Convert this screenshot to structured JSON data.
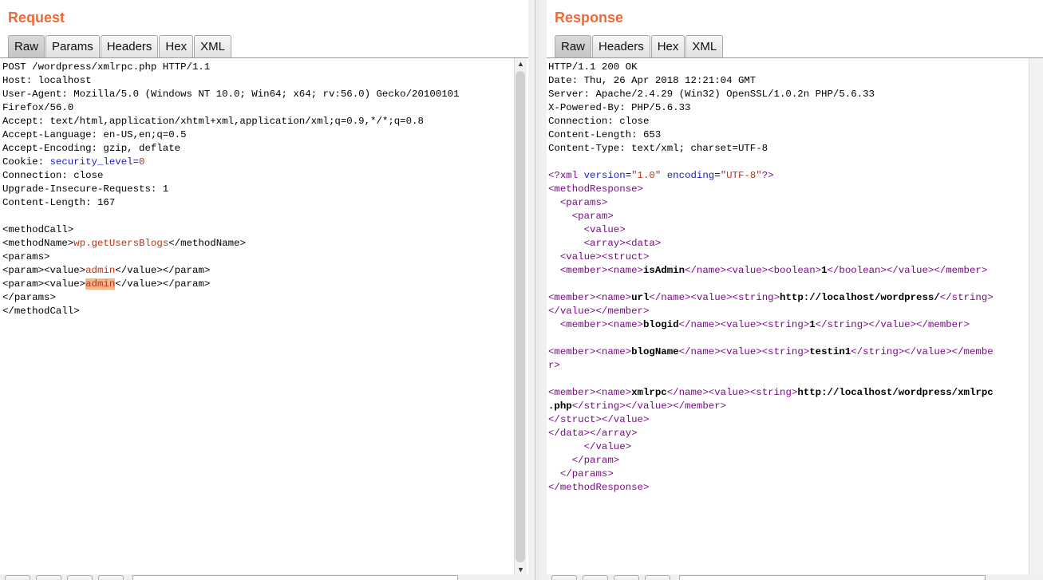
{
  "request": {
    "title": "Request",
    "tabs": [
      "Raw",
      "Params",
      "Headers",
      "Hex",
      "XML"
    ],
    "active_tab": "Raw",
    "headers": [
      "POST /wordpress/xmlrpc.php HTTP/1.1",
      "Host: localhost",
      "User-Agent: Mozilla/5.0 (Windows NT 10.0; Win64; x64; rv:56.0) Gecko/20100101",
      "Firefox/56.0",
      "Accept: text/html,application/xhtml+xml,application/xml;q=0.9,*/*;q=0.8",
      "Accept-Language: en-US,en;q=0.5",
      "Accept-Encoding: gzip, deflate"
    ],
    "cookie_label": "Cookie: ",
    "cookie_key": "security_level",
    "cookie_eq": "=",
    "cookie_value": "0",
    "headers2": [
      "Connection: close",
      "Upgrade-Insecure-Requests: 1",
      "Content-Length: 167"
    ],
    "body": {
      "method_call_open": "<methodCall>",
      "method_name_open": "<methodName>",
      "method_name": "wp.getUsersBlogs",
      "method_name_close": "</methodName>",
      "params_open": "<params>",
      "param_value_open": "<param><value>",
      "username": "admin",
      "param_value_close": "</value></param>",
      "password": "admin",
      "params_close": "</params>",
      "method_call_close": "</methodCall>"
    }
  },
  "response": {
    "title": "Response",
    "tabs": [
      "Raw",
      "Headers",
      "Hex",
      "XML"
    ],
    "active_tab": "Raw",
    "headers": [
      "HTTP/1.1 200 OK",
      "Date: Thu, 26 Apr 2018 12:21:04 GMT",
      "Server: Apache/2.4.29 (Win32) OpenSSL/1.0.2n PHP/5.6.33",
      "X-Powered-By: PHP/5.6.33",
      "Connection: close",
      "Content-Length: 653",
      "Content-Type: text/xml; charset=UTF-8"
    ],
    "xml": {
      "decl_open": "<?xml ",
      "version_attr": "version",
      "version_val": "\"1.0\"",
      "encoding_attr": "encoding",
      "encoding_val": "\"UTF-8\"",
      "decl_close": "?>",
      "is_admin_name": "isAdmin",
      "is_admin_value": "1",
      "url_name": "url",
      "url_value": "http://localhost/wordpress/",
      "blogid_name": "blogid",
      "blogid_value": "1",
      "blogname_name": "blogName",
      "blogname_value": "testin1",
      "xmlrpc_name": "xmlrpc",
      "xmlrpc_value_a": "http://localhost/wordpress/xmlrpc",
      "xmlrpc_value_b": ".php"
    }
  },
  "colors": {
    "title": "#ee6a35",
    "tag": "#7a0b84",
    "attr_name": "#1c1cc0",
    "attr_value": "#b8351a",
    "highlight": "#f7b688"
  }
}
